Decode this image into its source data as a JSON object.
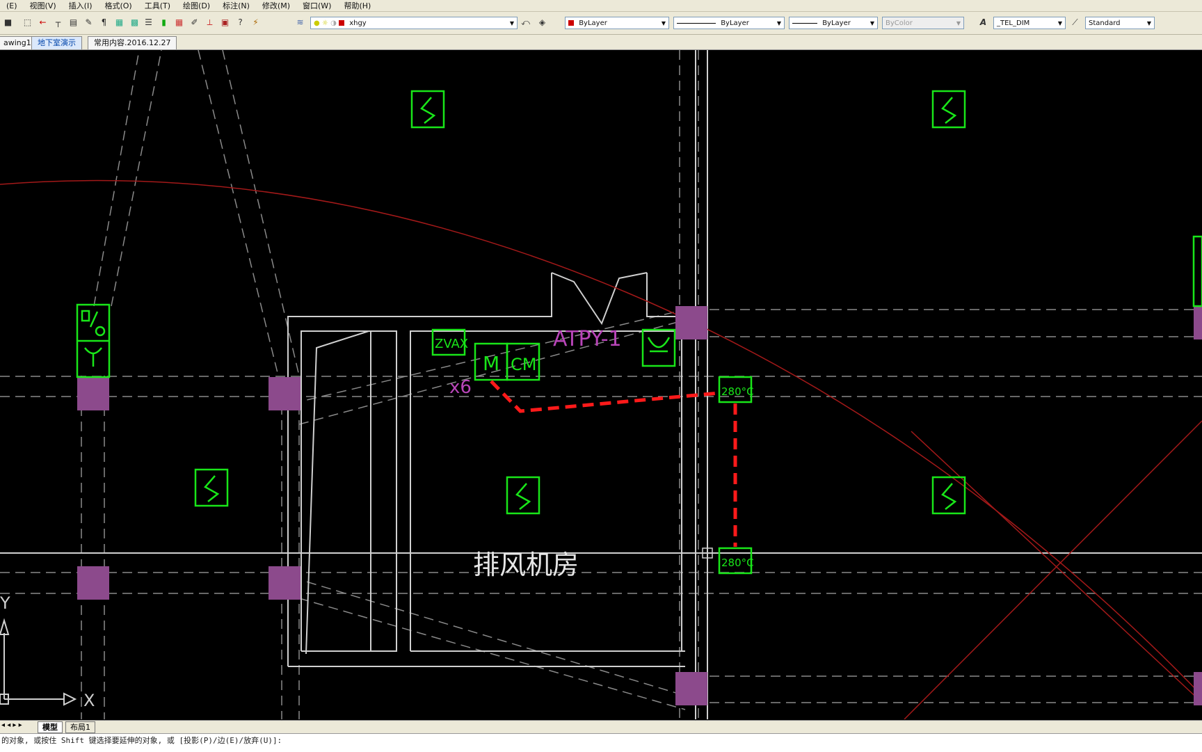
{
  "menubar": {
    "items": [
      "(E)",
      "视图(V)",
      "插入(I)",
      "格式(O)",
      "工具(T)",
      "绘图(D)",
      "标注(N)",
      "修改(M)",
      "窗口(W)",
      "帮助(H)"
    ]
  },
  "toolbar": {
    "layer_name": "xhgy",
    "color": "ByLayer",
    "linetype": "ByLayer",
    "lineweight": "ByLayer",
    "plotstyle": "ByColor",
    "text_style": "_TEL_DIM",
    "dim_style": "Standard",
    "color_swatch": "#cc0000"
  },
  "tabs": [
    "awing1",
    "地下室演示",
    "常用内容.2016.12.27"
  ],
  "active_tab_index": 1,
  "drawing": {
    "room_label": "排风机房",
    "equipment_label": "ATPY-1",
    "count_label": "x6",
    "zvax_label": "ZVAX",
    "fan_label": "M",
    "fan_label_2": "CM",
    "damper_1": "280°C",
    "damper_2": "280°C",
    "ucs_x": "X",
    "ucs_y": "Y"
  },
  "layout_tabs": [
    "模型",
    "布局1"
  ],
  "command_line": "的对象, 或按住 Shift 键选择要延伸的对象, 或 [投影(P)/边(E)/放弃(U)]:",
  "colors": {
    "green": "#19e619",
    "purple_pillar": "#8c4a8c",
    "magenta_text": "#b845b8",
    "red_line": "#ff1a1a",
    "arc": "#a31919",
    "white_line": "#cfcfcf"
  }
}
